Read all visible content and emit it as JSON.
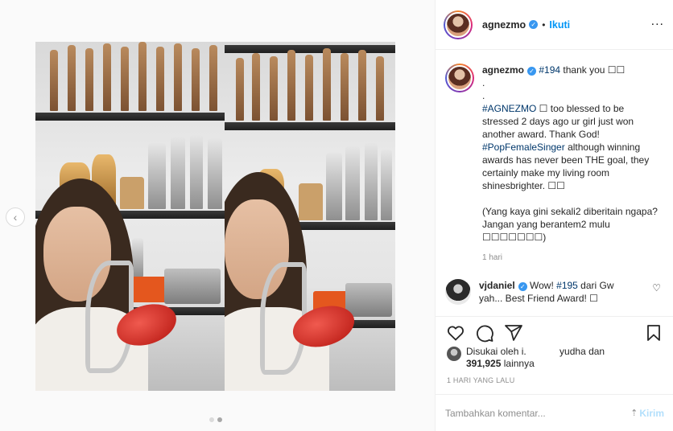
{
  "header": {
    "username": "agnezmo",
    "separator": "•",
    "follow_label": "Ikuti",
    "more_label": "..."
  },
  "caption": {
    "username": "agnezmo",
    "tag1": "#194",
    "line1_rest": " thank you ☐☐",
    "dot1": ".",
    "dot2": ".",
    "tag2": "#AGNEZMO",
    "body1": " ☐ too blessed to be stressed 2 days ago ur girl just won another award. Thank God!",
    "tag3": "#PopFemaleSinger",
    "body2": " although winning awards has never been THE goal, they certainly make my living room shinesbrighter. ☐☐",
    "body3": "(Yang kaya gini sekali2 diberitain ngapa? Jangan yang berantem2 mulu ☐☐☐☐☐☐☐)",
    "time": "1 hari"
  },
  "comment": {
    "username": "vjdaniel",
    "text_pre": " Wow! ",
    "tag": "#195",
    "text_post": " dari Gw yah... Best Friend Award! ☐"
  },
  "likes": {
    "prefix": "Disukai oleh i.",
    "mid": "yudha dan",
    "count": "391,925",
    "suffix": "lainnya"
  },
  "date": "1 HARI YANG LALU",
  "add_comment": {
    "placeholder": "Tambahkan komentar...",
    "post_label": "Kirim"
  },
  "nav": {
    "prev_icon": "‹"
  },
  "colors": {
    "accent": "#0095f6",
    "verified": "#3897f0",
    "hashtag": "#00376b"
  }
}
